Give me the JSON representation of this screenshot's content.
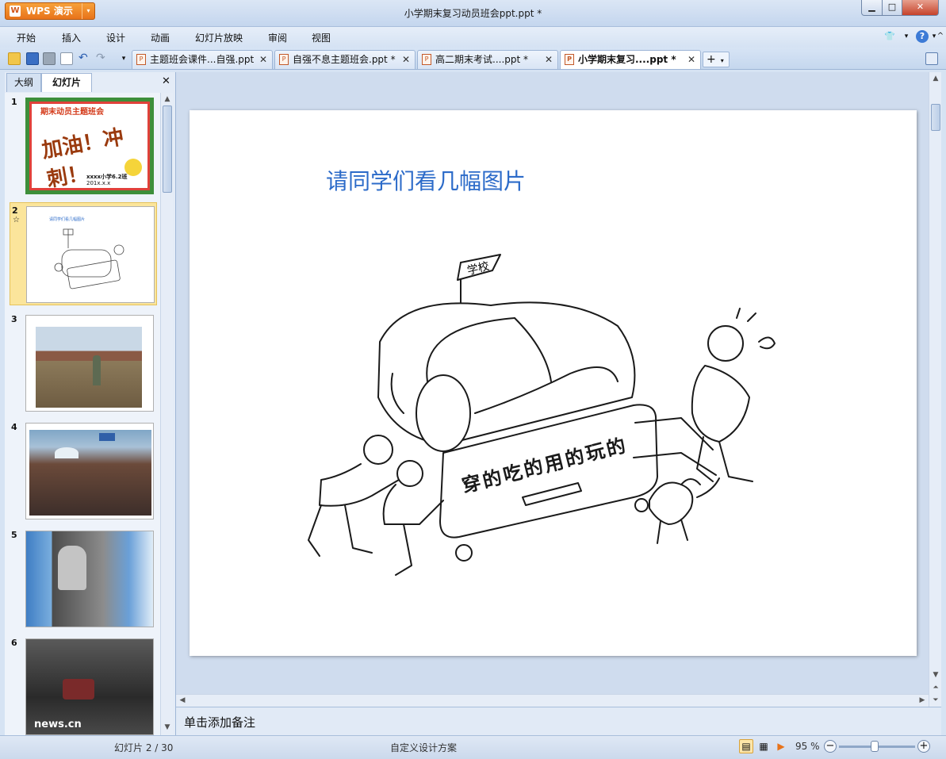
{
  "app": {
    "name": "WPS 演示",
    "logo": "W",
    "window_title": "小学期末复习动员班会ppt.ppt *"
  },
  "menu": [
    "开始",
    "插入",
    "设计",
    "动画",
    "幻灯片放映",
    "审阅",
    "视图"
  ],
  "tabs": [
    {
      "label": "主题班会课件...自强.ppt"
    },
    {
      "label": "自强不息主题班会.ppt *"
    },
    {
      "label": "高二期末考试....ppt *"
    },
    {
      "label": "小学期末复习....ppt *"
    }
  ],
  "panel": {
    "tab_outline": "大纲",
    "tab_slides": "幻灯片"
  },
  "slides": [
    {
      "num": "1",
      "title": "期末动员主题班会",
      "big": "加油！冲刺！",
      "school": "xxxx小学6.2班",
      "date": "201x.x.x"
    },
    {
      "num": "2",
      "star": "☆",
      "title": "请同学们看几幅图片",
      "bag_text": "穿的吃的用的玩的"
    },
    {
      "num": "3"
    },
    {
      "num": "4"
    },
    {
      "num": "5"
    },
    {
      "num": "6",
      "caption": "news.cn"
    }
  ],
  "current_slide": {
    "title": "请同学们看几幅图片",
    "flag_text": "学校",
    "bag_text": [
      "穿",
      "的",
      "吃",
      "的",
      "用",
      "的",
      "玩",
      "的"
    ]
  },
  "notes_placeholder": "单击添加备注",
  "status": {
    "slide_counter": "幻灯片 2 / 30",
    "design": "自定义设计方案",
    "zoom": "95 %"
  },
  "colors": {
    "title_blue": "#2c6bc9",
    "accent_orange": "#e8731a",
    "selected_thumb": "#fbe59b"
  }
}
